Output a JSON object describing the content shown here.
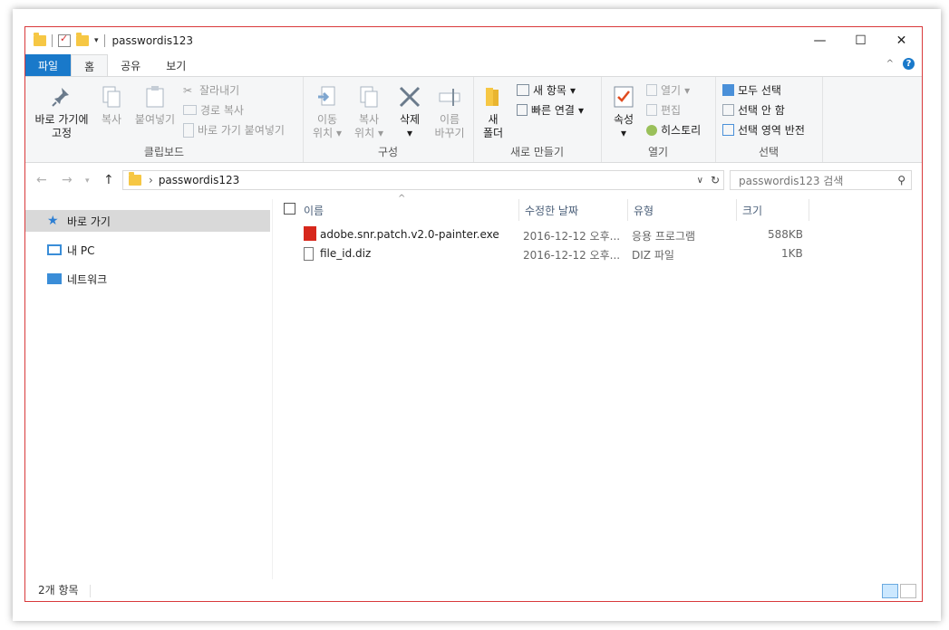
{
  "window": {
    "title": "passwordis123",
    "controls": {
      "minimize": "—",
      "maximize": "☐",
      "close": "✕"
    }
  },
  "ribbon_tabs": [
    "파일",
    "홈",
    "공유",
    "보기"
  ],
  "ribbon": {
    "clipboard": {
      "pin_line1": "바로 가기에",
      "pin_line2": "고정",
      "copy": "복사",
      "paste": "붙여넣기",
      "cut": "잘라내기",
      "copy_path": "경로 복사",
      "paste_shortcut": "바로 가기 붙여넣기",
      "label": "클립보드"
    },
    "organize": {
      "move_line1": "이동",
      "move_line2": "위치",
      "copy_line1": "복사",
      "copy_line2": "위치",
      "delete": "삭제",
      "rename_line1": "이름",
      "rename_line2": "바꾸기",
      "label": "구성"
    },
    "new": {
      "folder_line1": "새",
      "folder_line2": "폴더",
      "new_item": "새 항목",
      "easy_access": "빠른 연결",
      "label": "새로 만들기"
    },
    "open": {
      "properties": "속성",
      "open": "열기",
      "edit": "편집",
      "history": "히스토리",
      "label": "열기"
    },
    "select": {
      "select_all": "모두 선택",
      "select_none": "선택 안 함",
      "invert": "선택 영역 반전",
      "label": "선택"
    }
  },
  "address": {
    "path": "passwordis123",
    "search_placeholder": "passwordis123 검색"
  },
  "nav_pane": [
    {
      "label": "바로 가기",
      "icon": "star-icon",
      "selected": true
    },
    {
      "label": "내 PC",
      "icon": "pc-icon",
      "selected": false
    },
    {
      "label": "네트워크",
      "icon": "network-icon",
      "selected": false
    }
  ],
  "columns": [
    "이름",
    "수정한 날짜",
    "유형",
    "크기"
  ],
  "files": [
    {
      "name": "adobe.snr.patch.v2.0-painter.exe",
      "date": "2016-12-12 오후...",
      "type": "응용 프로그램",
      "size": "588KB",
      "icon": "adobe-exe-icon"
    },
    {
      "name": "file_id.diz",
      "date": "2016-12-12 오후...",
      "type": "DIZ 파일",
      "size": "1KB",
      "icon": "document-icon"
    }
  ],
  "status": {
    "count": "2개 항목"
  },
  "colors": {
    "accent": "#1979ca",
    "selection": "#d9d9d9",
    "border": "#d9393b"
  }
}
